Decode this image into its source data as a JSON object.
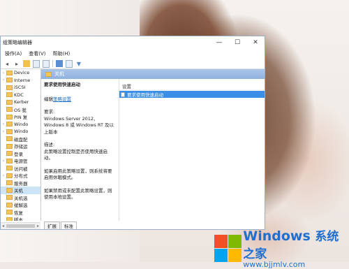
{
  "window": {
    "title": "组策略编辑器",
    "controls": [
      "—",
      "☐",
      "✕"
    ]
  },
  "menu": [
    "操作(A)",
    "查看(V)",
    "帮助(H)"
  ],
  "tree": {
    "items": [
      {
        "label": "Device",
        "arrow": "›",
        "sel": false
      },
      {
        "label": "Interne",
        "arrow": "›",
        "sel": false
      },
      {
        "label": "iSCSI",
        "arrow": "",
        "sel": false
      },
      {
        "label": "KDC",
        "arrow": "",
        "sel": false
      },
      {
        "label": "Kerber",
        "arrow": "",
        "sel": false
      },
      {
        "label": "OS 我",
        "arrow": "",
        "sel": false
      },
      {
        "label": "PIN 复",
        "arrow": "",
        "sel": false
      },
      {
        "label": "Windo",
        "arrow": "›",
        "sel": false
      },
      {
        "label": "Windo",
        "arrow": "›",
        "sel": false
      },
      {
        "label": "磁盘配",
        "arrow": "",
        "sel": false
      },
      {
        "label": "存储运",
        "arrow": "",
        "sel": false
      },
      {
        "label": "登录",
        "arrow": "",
        "sel": false
      },
      {
        "label": "电源管",
        "arrow": "›",
        "sel": false
      },
      {
        "label": "访问被",
        "arrow": "",
        "sel": false
      },
      {
        "label": "分布式",
        "arrow": "›",
        "sel": false
      },
      {
        "label": "服务器",
        "arrow": "",
        "sel": false
      },
      {
        "label": "关机",
        "arrow": "",
        "sel": true
      },
      {
        "label": "关机选",
        "arrow": "",
        "sel": false
      },
      {
        "label": "缓解选",
        "arrow": "",
        "sel": false
      },
      {
        "label": "恢复",
        "arrow": "",
        "sel": false
      },
      {
        "label": "脚本",
        "arrow": "",
        "sel": false
      },
      {
        "label": "可移动",
        "arrow": "",
        "sel": false
      }
    ]
  },
  "right": {
    "header": "关机",
    "description": {
      "title": "要求使用快速启动",
      "edit_prefix": "编辑",
      "edit_link": "策略设置",
      "req_label": "要求:",
      "req_text": "Windows Server 2012、Windows 8 或 Windows RT 及以上版本",
      "desc_label": "描述:",
      "desc_text": "此策略设置控制是否使用快速启动。",
      "enable_text": "如果启用此策略设置，则系统将要启用休眠模式。",
      "disable_text": "如果禁用或未配置此策略设置，则使用本地设置。"
    },
    "list": {
      "column": "设置",
      "rows": [
        "要求使用快速启动"
      ]
    }
  },
  "tabs": [
    "扩展",
    "标准"
  ],
  "watermark": {
    "brand": "Windows",
    "brand_suffix": "系统之家",
    "url": "www.bjjmlv.com",
    "colors": [
      "#f25022",
      "#7fba00",
      "#00a4ef",
      "#ffb900"
    ]
  }
}
